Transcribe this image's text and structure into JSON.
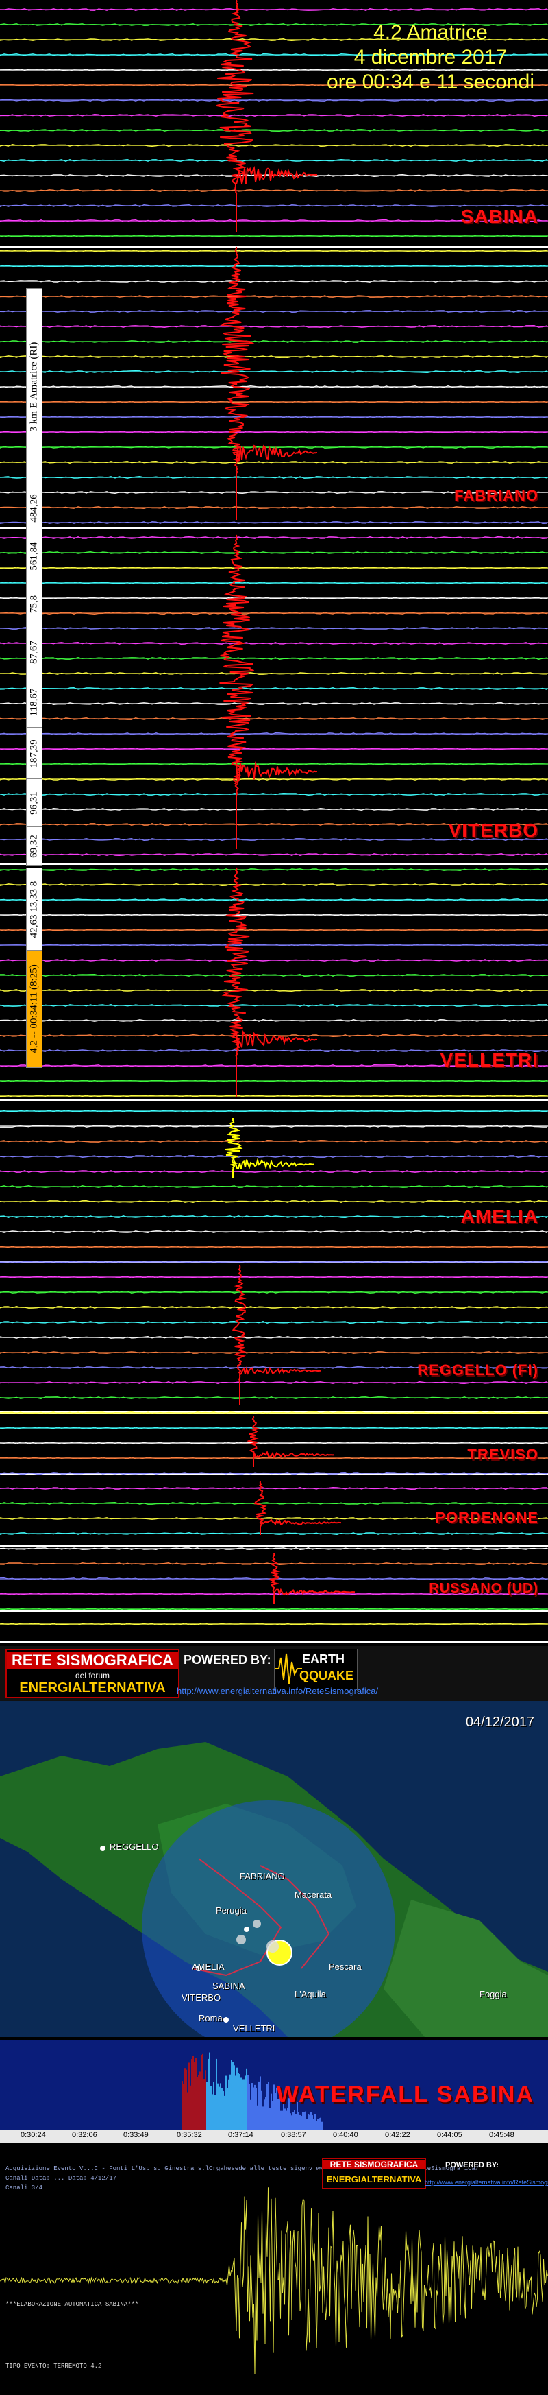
{
  "event": {
    "magnitude_title": "4.2 Amatrice",
    "date_line": "4 dicembre 2017",
    "time_line": "ore 00:34 e 11 secondi"
  },
  "side_labels": {
    "location_bar": "3 km E Amatrice (RI)",
    "dist1": "484,26",
    "dist2": "561,84",
    "dist3": "75,8",
    "dist4": "87,67",
    "dist5": "118,67",
    "dist6": "187,39",
    "dist7": "96,31",
    "dist8": "69,32",
    "coords": "42,63 13,33 8",
    "time_bar": "4,2 -- 00:34:11 (8:25)"
  },
  "stations": [
    {
      "name": "SABINA"
    },
    {
      "name": "FABRIANO"
    },
    {
      "name": "VITERBO"
    },
    {
      "name": "VELLETRI"
    },
    {
      "name": "AMELIA"
    },
    {
      "name": "REGGELLO (FI)"
    },
    {
      "name": "TREVISO"
    },
    {
      "name": "PORDENONE"
    },
    {
      "name": "RUSSANO (UD)"
    }
  ],
  "colors": {
    "red_trace": "#ff1010",
    "yellow_trace": "#ffff00",
    "background": "#000000",
    "label_red": "#ff1010",
    "title_yellow": "#ffff40"
  },
  "map": {
    "header": {
      "logo_line1": "RETE SISMOGRAFICA",
      "logo_line2": "del forum",
      "logo_line3": "ENERGIALTERNATIVA",
      "powered_by": "POWERED BY:",
      "eq_logo_1": "EARTH",
      "eq_logo_2": "QQUAKE",
      "url": "http://www.energialternativa.info/ReteSismografica/"
    },
    "date": "04/12/2017",
    "cities": [
      "FABRIANO",
      "Macerata",
      "Perugia",
      "AMELIA",
      "SABINA",
      "VITERBO",
      "Roma",
      "VELLETRI",
      "REGGELLO",
      "Pescara",
      "L'Aquila",
      "Foggia"
    ]
  },
  "waterfall": {
    "label": "WATERFALL SABINA",
    "ticks": [
      "0:30:24",
      "0:32:06",
      "0:33:49",
      "0:35:32",
      "0:37:14",
      "0:38:57",
      "0:40:40",
      "0:42:22",
      "0:44:05",
      "0:45:48"
    ]
  },
  "bottom_panel": {
    "info_lines": [
      "Acquisizione Evento V...C - Fonti L'Usb su Ginestra s.lOrgahesede alle teste sigenv www.energialternativa.info/ReteSismografica/",
      "Canali Data: ...  Data: 4/12/17",
      "Canali 3/4",
      "",
      "***ELABORAZIONE AUTOMATICA SABINA***",
      "TIPO EVENTO: TERREMOTO 4.2"
    ],
    "logo_a": "RETE SISMOGRAFICA",
    "logo_b": "ENERGIALTERNATIVA",
    "powered_by": "POWERED BY:",
    "url": "http://www.energialternativa.info/ReteSismografica/"
  }
}
